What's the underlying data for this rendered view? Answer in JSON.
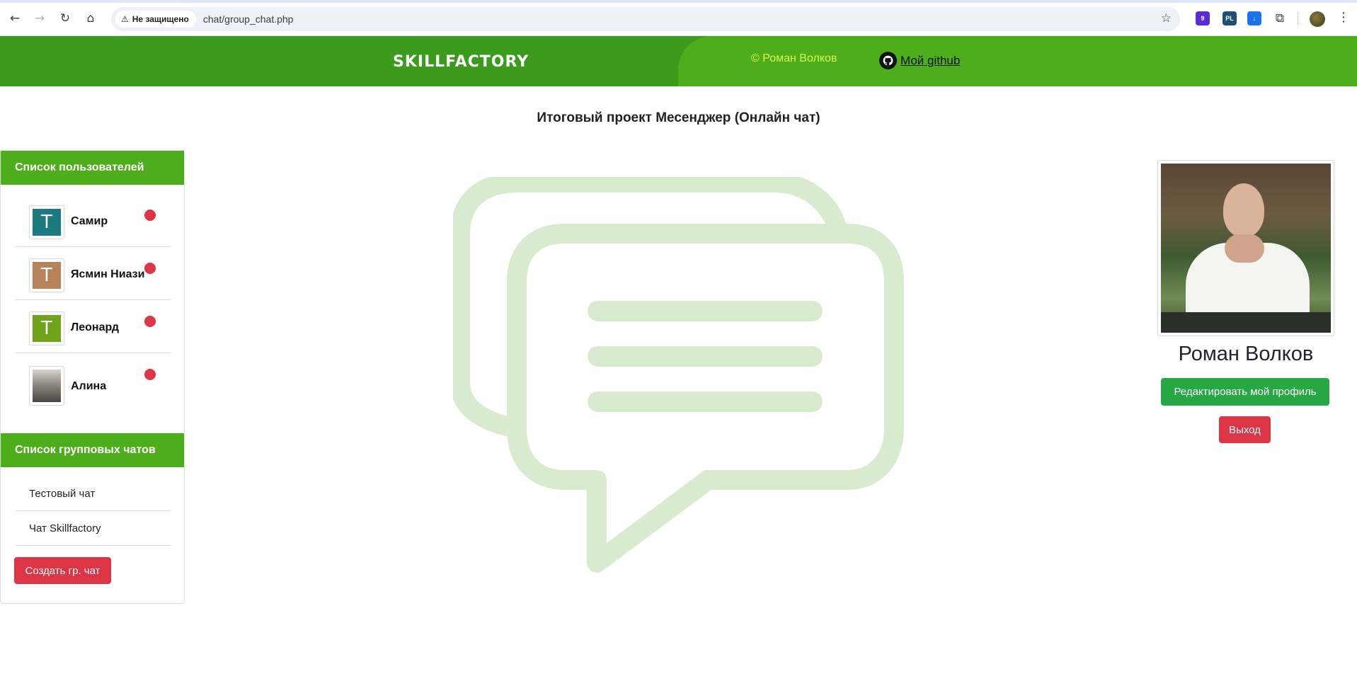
{
  "browser": {
    "security_label": "Не защищено",
    "url": "chat/group_chat.php",
    "icons": [
      "back-icon",
      "forward-icon",
      "reload-icon",
      "home-icon",
      "warning-icon",
      "star-icon",
      "extensions-icon",
      "menu-icon"
    ],
    "extension_badges": [
      "9",
      "PL"
    ]
  },
  "header": {
    "logo": "SKILLFACTORY",
    "copyright": "© Роман Волков",
    "github_link": "Мой github",
    "colors": {
      "header_left": "#3b9b1c",
      "header_right": "#4ead1b",
      "copyright_text": "#d7f84e"
    }
  },
  "page_title": "Итоговый проект Месенджер (Онлайн чат)",
  "sidebar": {
    "users_title": "Список пользователей",
    "users": [
      {
        "name": "Самир",
        "avatar_letter": "T",
        "avatar_color": "#1a7a80",
        "status": "offline"
      },
      {
        "name": "Ясмин Ниази",
        "avatar_letter": "T",
        "avatar_color": "#b58357",
        "status": "offline"
      },
      {
        "name": "Леонард",
        "avatar_letter": "T",
        "avatar_color": "#6ea31a",
        "status": "offline"
      },
      {
        "name": "Алина",
        "avatar_letter": "",
        "avatar_color": "#9a958e",
        "status": "offline"
      }
    ],
    "group_chats_title": "Список групповых чатов",
    "group_chats": [
      "Тестовый чат",
      "Чат Skillfactory"
    ],
    "create_button": "Создать гр. чат"
  },
  "profile": {
    "name": "Роман Волков",
    "edit_button": "Редактировать мой профиль",
    "logout_button": "Выход"
  },
  "colors": {
    "accent_green": "#4ead1b",
    "success_green": "#28a745",
    "danger_red": "#dc3545",
    "illustration_green": "#d9ebcf"
  }
}
